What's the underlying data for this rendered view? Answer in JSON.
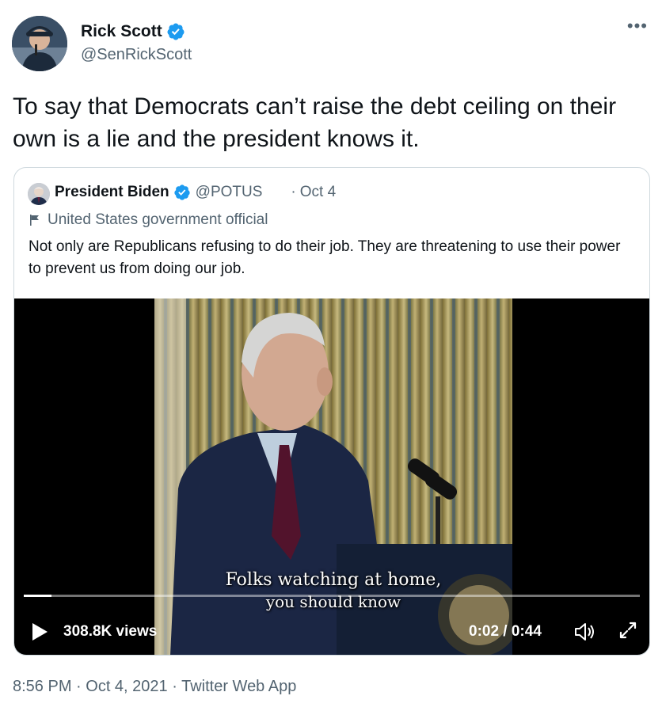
{
  "tweet": {
    "author_name": "Rick Scott",
    "author_handle": "@SenRickScott",
    "text": "To say that Democrats can’t raise the debt ceiling on their own is a lie and the president knows it.",
    "more_icon": "ellipsis-icon"
  },
  "quote": {
    "author_name": "President Biden",
    "author_handle": "@POTUS",
    "separator": "·",
    "date": "Oct 4",
    "label": "United States government official",
    "text": "Not only are Republicans refusing to do their job. They are threatening to use their power to prevent us from doing our job."
  },
  "video": {
    "caption_line1": "Folks watching at home,",
    "caption_line2": "you should know",
    "views": "308.8K views",
    "time": "0:02 / 0:44",
    "progress_fraction": 0.045
  },
  "footer": {
    "time": "8:56 PM",
    "sep1": " · ",
    "date": "Oct 4, 2021",
    "sep2": " · ",
    "app": "Twitter Web App"
  },
  "colors": {
    "verified": "#1d9bf0",
    "secondary_text": "#536471",
    "border": "#cfd9de"
  }
}
